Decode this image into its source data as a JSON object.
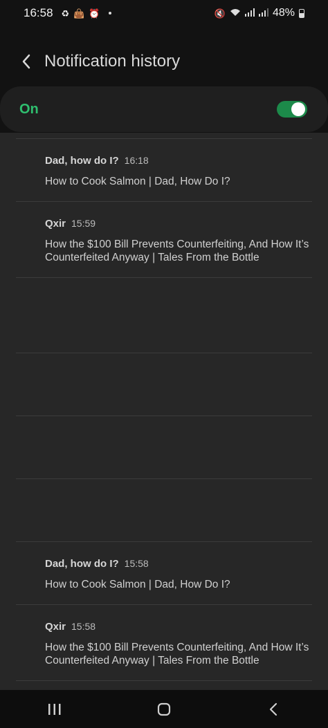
{
  "status_bar": {
    "time": "16:58",
    "battery": "48%"
  },
  "header": {
    "title": "Notification history"
  },
  "toggle": {
    "label": "On",
    "state": "on",
    "accent_color": "#2fbf6f"
  },
  "notifications": [
    {
      "app": "Dad, how do I?",
      "time": "16:18",
      "body": "How to Cook Salmon | Dad, How Do I?"
    },
    {
      "app": "Qxir",
      "time": "15:59",
      "body": "How the $100 Bill Prevents Counterfeiting, And How It’s Counterfeited Anyway | Tales From the Bottle"
    },
    {
      "app": "Dad, how do I?",
      "time": "15:58",
      "body": "How to Cook Salmon | Dad, How Do I?"
    },
    {
      "app": "Qxir",
      "time": "15:58",
      "body": "How the $100 Bill Prevents Counterfeiting, And How It’s Counterfeited Anyway | Tales From the Bottle"
    }
  ],
  "icons": {
    "back": "back-arrow-icon",
    "nav_recent": "recent-apps-icon",
    "nav_home": "home-icon",
    "nav_back": "back-icon"
  }
}
